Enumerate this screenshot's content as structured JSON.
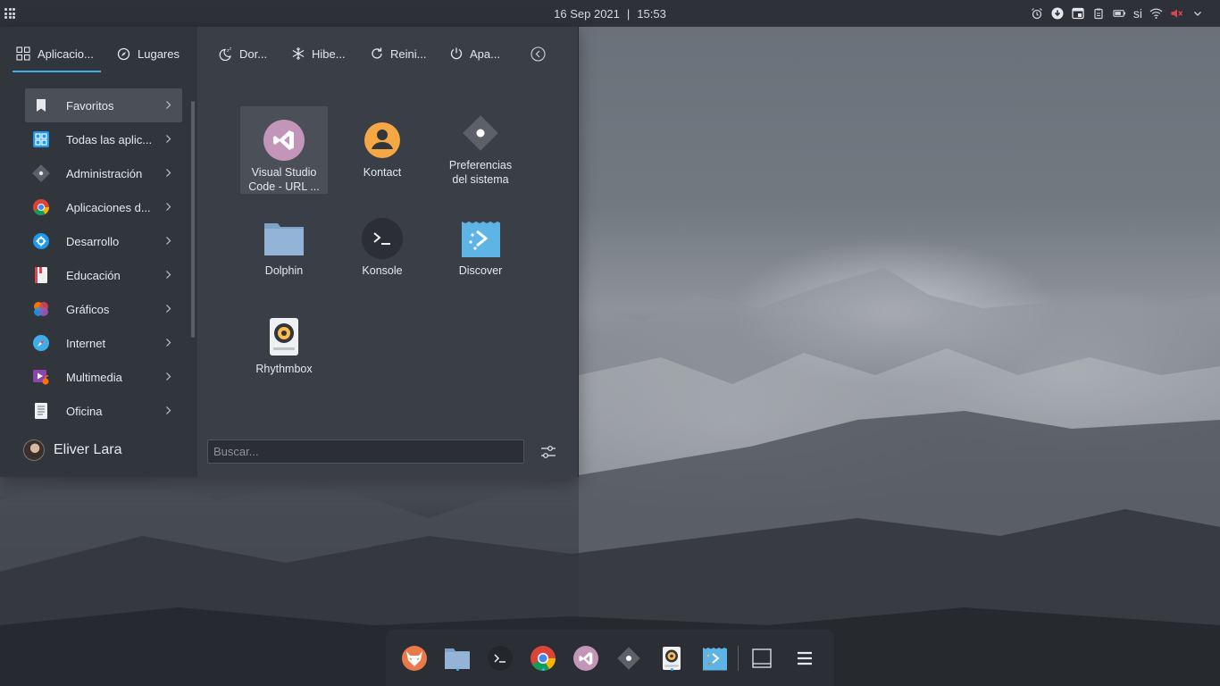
{
  "top_panel": {
    "date": "16 Sep 2021",
    "separator": "|",
    "time": "15:53",
    "keyboard_layout": "si"
  },
  "launcher": {
    "tabs": [
      {
        "label": "Aplicacio...",
        "icon": "grid-icon",
        "active": true
      },
      {
        "label": "Lugares",
        "icon": "compass-icon",
        "active": false
      }
    ],
    "power": [
      {
        "label": "Dor...",
        "icon": "sleep-icon"
      },
      {
        "label": "Hibe...",
        "icon": "snowflake-icon"
      },
      {
        "label": "Reini...",
        "icon": "restart-icon"
      },
      {
        "label": "Apa...",
        "icon": "power-icon"
      }
    ],
    "categories": [
      {
        "label": "Favoritos",
        "icon": "bookmark-icon",
        "active": true
      },
      {
        "label": "Todas las aplic...",
        "icon": "all-apps-icon"
      },
      {
        "label": "Administración",
        "icon": "admin-icon"
      },
      {
        "label": "Aplicaciones d...",
        "icon": "chrome-apps-icon"
      },
      {
        "label": "Desarrollo",
        "icon": "development-icon"
      },
      {
        "label": "Educación",
        "icon": "education-icon"
      },
      {
        "label": "Gráficos",
        "icon": "graphics-icon"
      },
      {
        "label": "Internet",
        "icon": "internet-icon"
      },
      {
        "label": "Multimedia",
        "icon": "multimedia-icon"
      },
      {
        "label": "Oficina",
        "icon": "office-icon"
      }
    ],
    "user": {
      "name": "Eliver Lara"
    },
    "apps": [
      {
        "line1": "Visual Studio",
        "line2": "Code - URL ...",
        "icon": "vscode-icon",
        "selected": true
      },
      {
        "line1": "Kontact",
        "line2": "",
        "icon": "kontact-icon"
      },
      {
        "line1": "Preferencias",
        "line2": "del sistema",
        "icon": "system-settings-icon"
      },
      {
        "line1": "Dolphin",
        "line2": "",
        "icon": "folder-icon"
      },
      {
        "line1": "Konsole",
        "line2": "",
        "icon": "terminal-icon"
      },
      {
        "line1": "Discover",
        "line2": "",
        "icon": "discover-icon"
      },
      {
        "line1": "Rhythmbox",
        "line2": "",
        "icon": "rhythmbox-icon"
      }
    ],
    "search": {
      "placeholder": "Buscar..."
    }
  },
  "dock": {
    "items": [
      "firefox-icon",
      "folder-icon",
      "terminal-icon",
      "chrome-icon",
      "vscode-icon",
      "system-settings-icon",
      "rhythmbox-icon",
      "discover-icon",
      "show-desktop-icon",
      "menu-icon"
    ]
  },
  "colors": {
    "accent": "#3daee9",
    "panel": "#2e3138",
    "launcher_left": "#31353c",
    "launcher_right": "#3a3e46"
  }
}
